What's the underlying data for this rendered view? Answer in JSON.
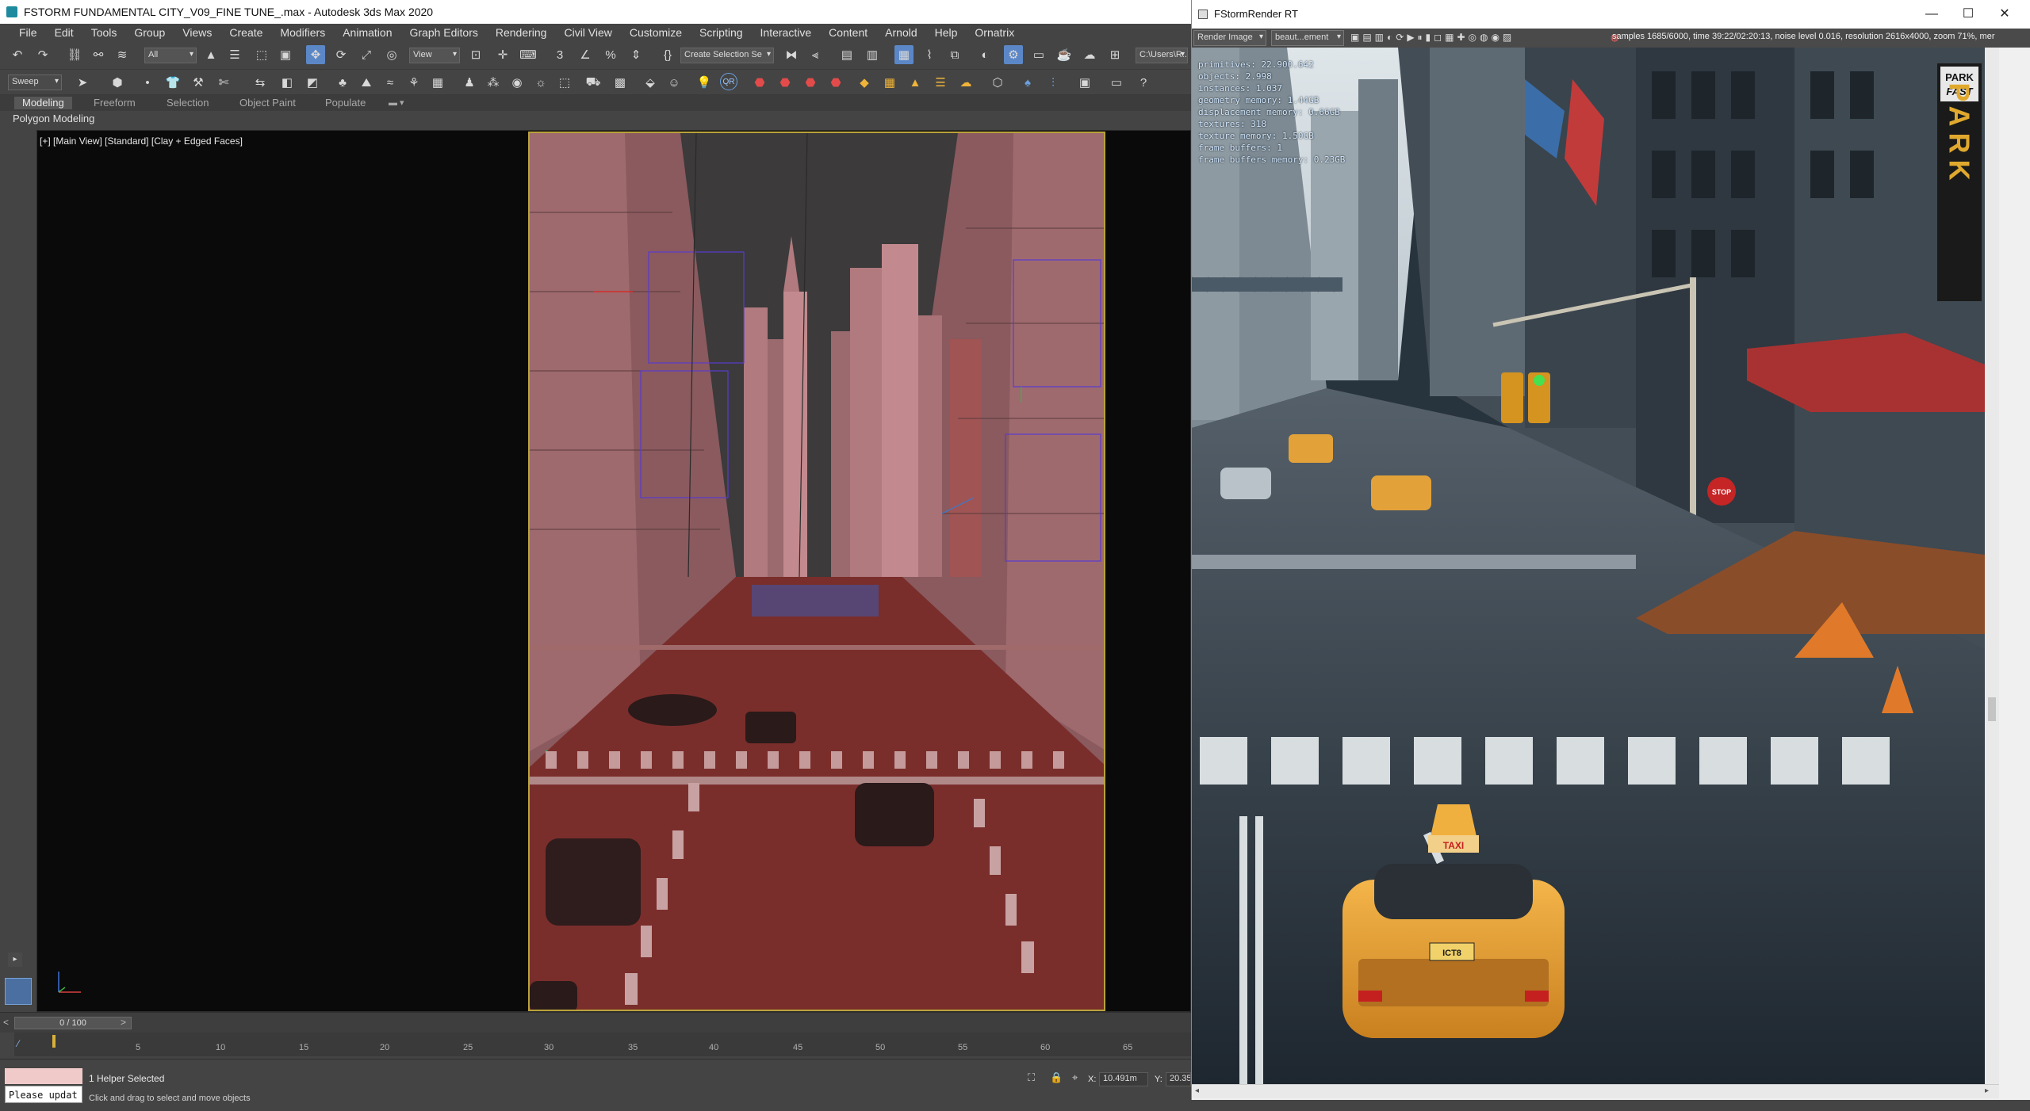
{
  "max_window": {
    "title": "FSTORM FUNDAMENTAL CITY_V09_FINE TUNE_.max - Autodesk 3ds Max 2020",
    "menu": [
      "File",
      "Edit",
      "Tools",
      "Group",
      "Views",
      "Create",
      "Modifiers",
      "Animation",
      "Graph Editors",
      "Rendering",
      "Civil View",
      "Customize",
      "Scripting",
      "Interactive",
      "Content",
      "Arnold",
      "Help",
      "Ornatrix"
    ],
    "toolbar": {
      "selection_filter": "All",
      "reference_coord": "View",
      "named_selection": "Create Selection Se",
      "path": "C:\\Users\\R..."
    },
    "ribbon_tabs": [
      "Modeling",
      "Freeform",
      "Selection",
      "Object Paint",
      "Populate"
    ],
    "ribbon_sub": "Polygon Modeling",
    "sweep_label": "Sweep",
    "viewport_label": "[+] [Main View] [Standard] [Clay + Edged Faces]",
    "time_slider": "0 / 100",
    "timeline_ticks": [
      "5",
      "10",
      "15",
      "20",
      "25",
      "30",
      "35",
      "40",
      "45",
      "50",
      "55",
      "60",
      "65"
    ],
    "status": {
      "selection": "1 Helper Selected",
      "prompt": "Click and drag to select and move objects",
      "maxscript_input": "Please updat",
      "x_label": "X:",
      "x_value": "10.491m",
      "y_label": "Y:",
      "y_value": "20.35"
    }
  },
  "fstorm_window": {
    "title": "FStormRender RT",
    "controls": {
      "minimize": "—",
      "maximize": "☐",
      "close": "✕"
    },
    "render_mode": "Render Image",
    "element": "beaut...ement",
    "render_info": "samples 1685/6000,  time 39:22/02:20:13,  noise level 0.016,  resolution 2616x4000,  zoom 71%,  mer",
    "stats": [
      "primitives: 22.900.642",
      "objects: 2.998",
      "instances: 1.037",
      "geometry memory: 1.44GB",
      "displacement memory: 0.66GB",
      "textures: 318",
      "texture memory: 1.50GB",
      "frame buffers: 1",
      "frame buffers memory: 0.23GB"
    ],
    "scene_text": {
      "park_sign_top": "PARK",
      "park_sign_bottom": "FAST",
      "park_vertical": "PARK",
      "taxi_sign": "TAXI",
      "plate": "ICT8",
      "stop": "STOP"
    }
  }
}
